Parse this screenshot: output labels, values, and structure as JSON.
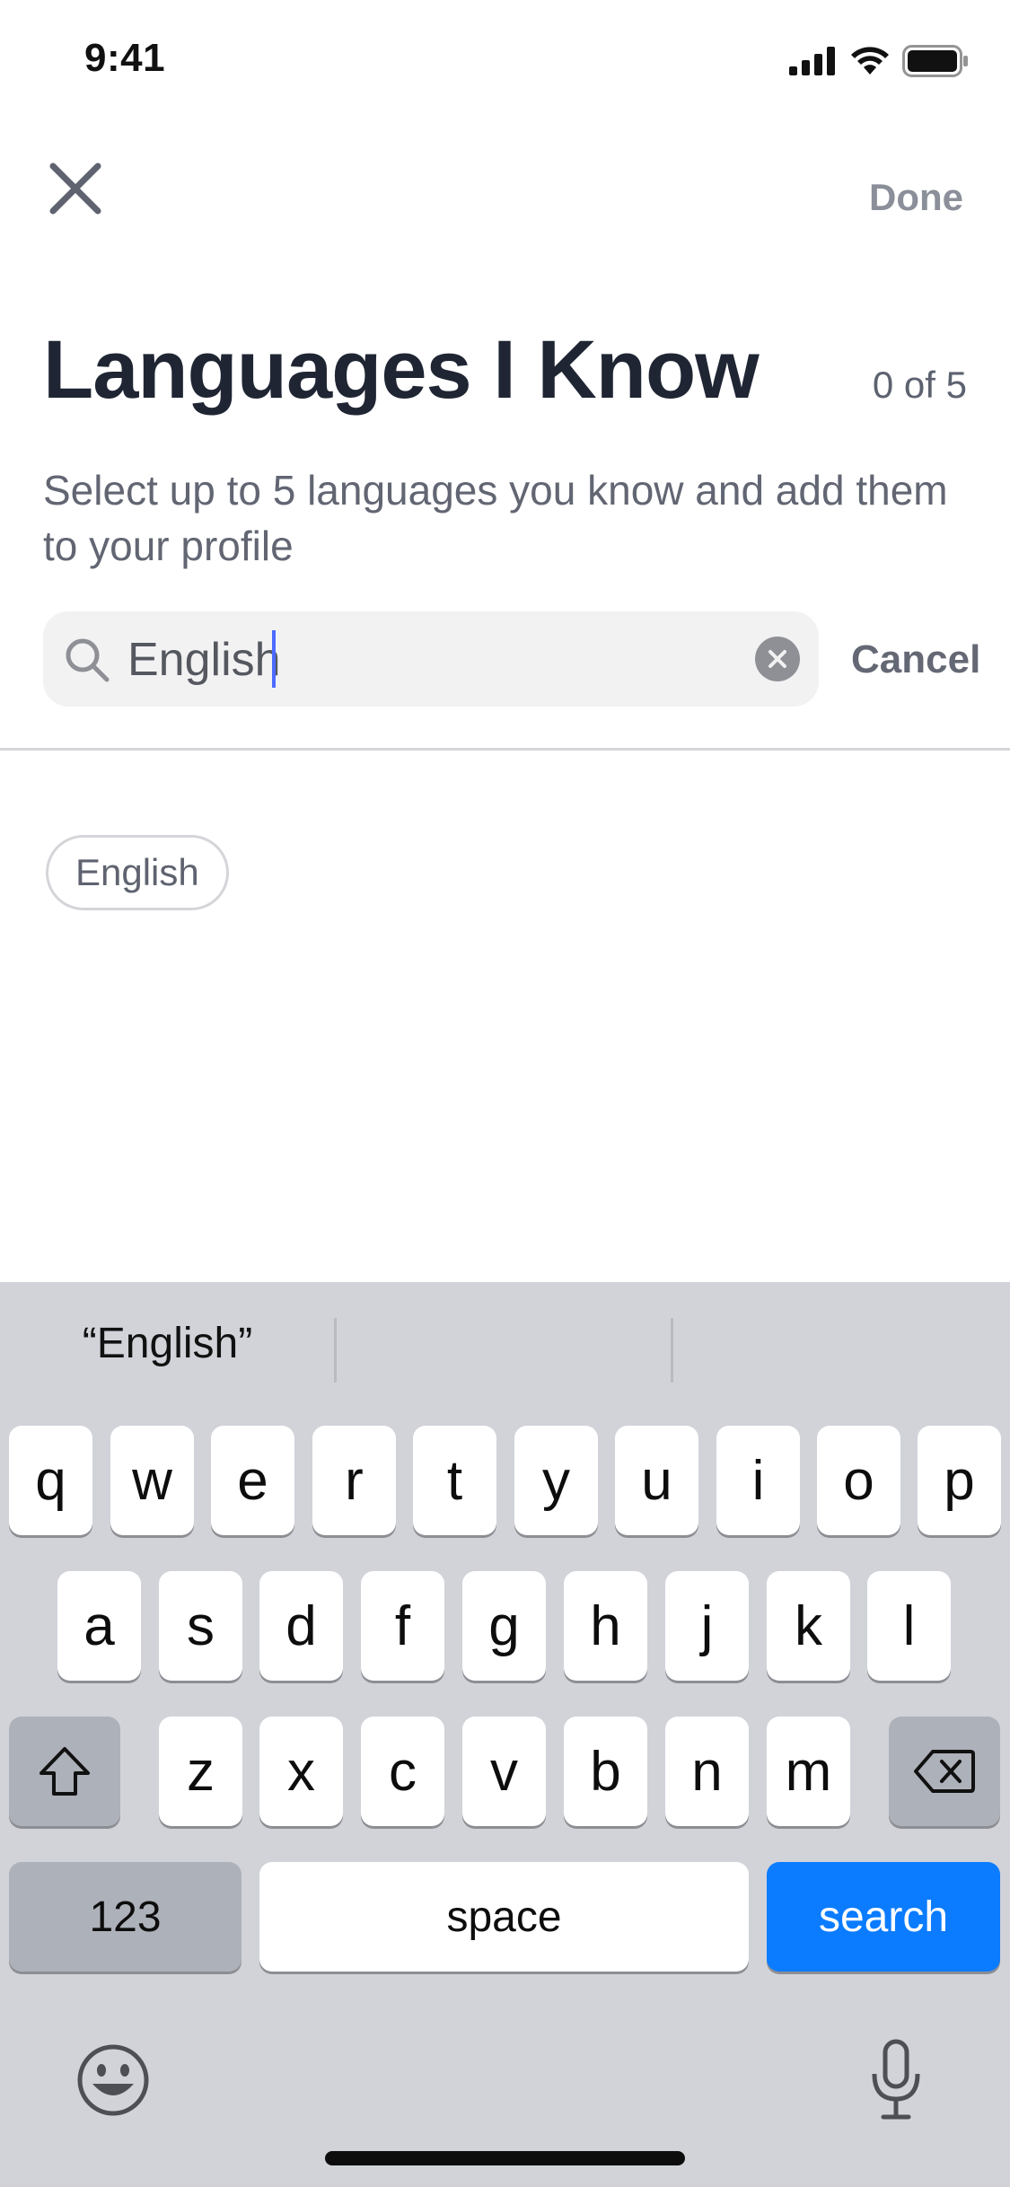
{
  "status_bar": {
    "time": "9:41"
  },
  "nav": {
    "close_icon": "close-icon",
    "done_label": "Done"
  },
  "header": {
    "title": "Languages I Know",
    "counter": "0 of 5",
    "subtitle": "Select up to 5 languages you know and add them to your profile"
  },
  "search": {
    "value": "English",
    "cancel_label": "Cancel"
  },
  "results": {
    "chips": [
      "English"
    ]
  },
  "keyboard": {
    "suggestions": [
      "“English”",
      "",
      ""
    ],
    "row1": [
      "q",
      "w",
      "e",
      "r",
      "t",
      "y",
      "u",
      "i",
      "o",
      "p"
    ],
    "row2": [
      "a",
      "s",
      "d",
      "f",
      "g",
      "h",
      "j",
      "k",
      "l"
    ],
    "row3": [
      "z",
      "x",
      "c",
      "v",
      "b",
      "n",
      "m"
    ],
    "numbers_label": "123",
    "space_label": "space",
    "search_label": "search"
  },
  "colors": {
    "accent": "#0b7cff",
    "caret": "#4c6bff",
    "keyboard_bg": "#d1d3d9"
  }
}
